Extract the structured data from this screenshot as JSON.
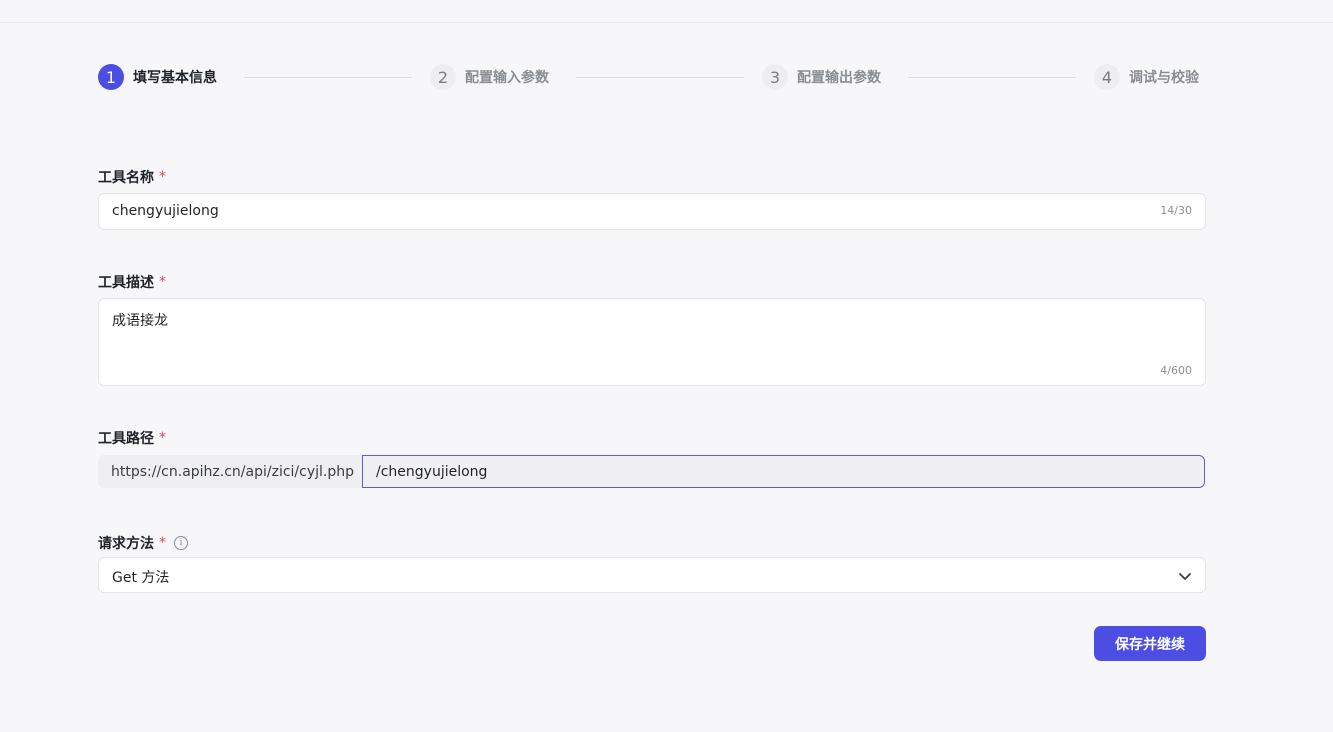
{
  "steps": [
    {
      "number": "1",
      "label": "填写基本信息",
      "active": true
    },
    {
      "number": "2",
      "label": "配置输入参数",
      "active": false
    },
    {
      "number": "3",
      "label": "配置输出参数",
      "active": false
    },
    {
      "number": "4",
      "label": "调试与校验",
      "active": false
    }
  ],
  "form": {
    "tool_name": {
      "label": "工具名称",
      "required_mark": "*",
      "value": "chengyujielong",
      "counter": "14/30"
    },
    "tool_desc": {
      "label": "工具描述",
      "required_mark": "*",
      "value": "成语接龙",
      "counter": "4/600"
    },
    "tool_path": {
      "label": "工具路径",
      "required_mark": "*",
      "prefix": "https://cn.apihz.cn/api/zici/cyjl.php",
      "value": "/chengyujielong"
    },
    "method": {
      "label": "请求方法",
      "required_mark": "*",
      "info_icon": "info-icon",
      "value": "Get 方法",
      "dropdown_icon": "chevron-down-icon"
    }
  },
  "actions": {
    "save_label": "保存并继续"
  },
  "colors": {
    "accent": "#4c4ee3",
    "required": "#e5484d",
    "background": "#f7f7f9"
  }
}
